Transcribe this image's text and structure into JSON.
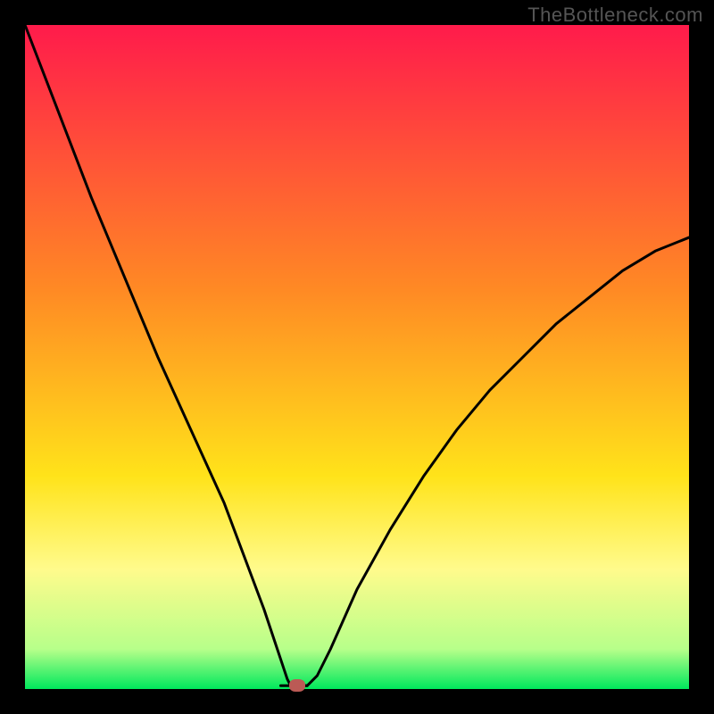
{
  "watermark": "TheBottleneck.com",
  "chart_data": {
    "type": "line",
    "title": "",
    "xlabel": "",
    "ylabel": "",
    "xlim": [
      0,
      100
    ],
    "ylim": [
      0,
      100
    ],
    "grid": false,
    "legend": false,
    "background_gradient_stops": [
      {
        "position": 0,
        "color": "#ff1b4b"
      },
      {
        "position": 40,
        "color": "#ff8a24"
      },
      {
        "position": 68,
        "color": "#ffe31a"
      },
      {
        "position": 82,
        "color": "#fffb8c"
      },
      {
        "position": 94,
        "color": "#b7ff8a"
      },
      {
        "position": 100,
        "color": "#00e85c"
      }
    ],
    "series": [
      {
        "name": "bottleneck-curve",
        "type": "line",
        "stroke": "#000000",
        "x": [
          0,
          5,
          10,
          15,
          20,
          25,
          30,
          33,
          36,
          38,
          39,
          39.5,
          40,
          41,
          42.5,
          44,
          46,
          50,
          55,
          60,
          65,
          70,
          75,
          80,
          85,
          90,
          95,
          100
        ],
        "y": [
          100,
          87,
          74,
          62,
          50,
          39,
          28,
          20,
          12,
          6,
          3,
          1.5,
          0.5,
          0.5,
          0.5,
          2,
          6,
          15,
          24,
          32,
          39,
          45,
          50,
          55,
          59,
          63,
          66,
          68
        ]
      },
      {
        "name": "baseline-flat",
        "type": "line",
        "stroke": "#000000",
        "x": [
          38.5,
          42.5
        ],
        "y": [
          0.5,
          0.5
        ]
      }
    ],
    "marker": {
      "x": 41,
      "y": 0.5,
      "color": "#bb5a55",
      "shape": "rounded-rect"
    }
  }
}
